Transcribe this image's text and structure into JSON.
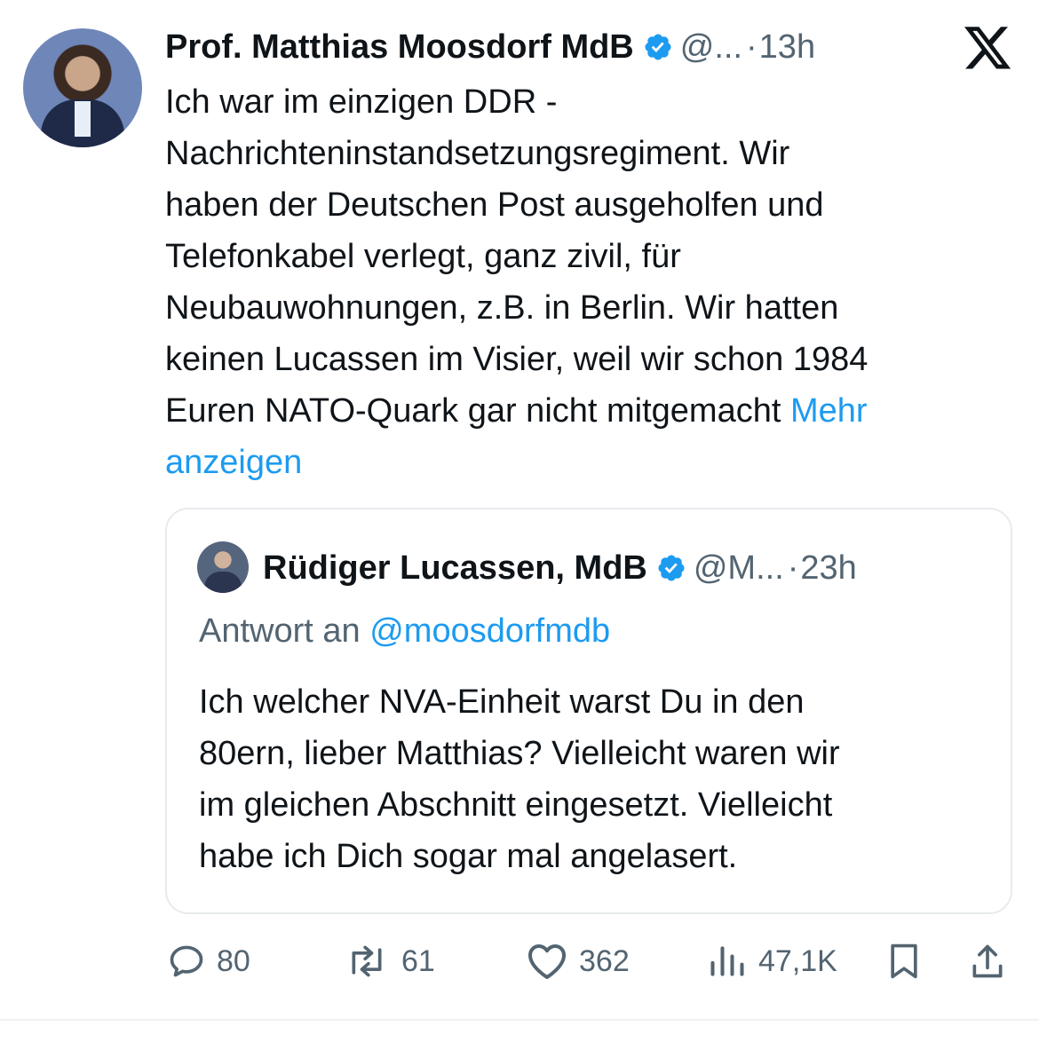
{
  "tweet": {
    "author_name": "Prof. Matthias Moosdorf MdB",
    "handle_truncated": "@...",
    "separator": "·",
    "time": "13h",
    "text_lines": [
      "Ich war im einzigen DDR -",
      "Nachrichteninstandsetzungsregiment. Wir",
      "haben der Deutschen Post ausgeholfen und",
      "Telefonkabel verlegt, ganz zivil, für",
      "Neubauwohnungen, z.B. in Berlin.  Wir hatten",
      "keinen Lucassen im Visier, weil wir schon 1984",
      "Euren NATO-Quark gar nicht mitgemacht"
    ],
    "show_more_first": "Mehr",
    "show_more_second": "anzeigen"
  },
  "quoted": {
    "author_name": "Rüdiger Lucassen, MdB",
    "handle_truncated": "@M...",
    "separator": "·",
    "time": "23h",
    "reply_prefix": "Antwort an",
    "reply_handle": "@moosdorfmdb",
    "text_lines": [
      "Ich welcher NVA-Einheit warst Du in den",
      "80ern, lieber Matthias? Vielleicht waren wir",
      "im gleichen Abschnitt eingesetzt. Vielleicht",
      "habe ich Dich sogar mal angelasert."
    ]
  },
  "actions": {
    "replies": "80",
    "reposts": "61",
    "likes": "362",
    "views": "47,1K"
  },
  "icons": {
    "verified": "verified-badge-icon",
    "logo": "x-logo-icon",
    "reply": "reply-icon",
    "repost": "repost-icon",
    "like": "heart-icon",
    "views": "views-chart-icon",
    "bookmark": "bookmark-icon",
    "share": "share-icon"
  },
  "colors": {
    "link": "#1d9bf0",
    "secondary_text": "#536471",
    "primary_text": "#0f1419",
    "border": "#e7ebee"
  }
}
